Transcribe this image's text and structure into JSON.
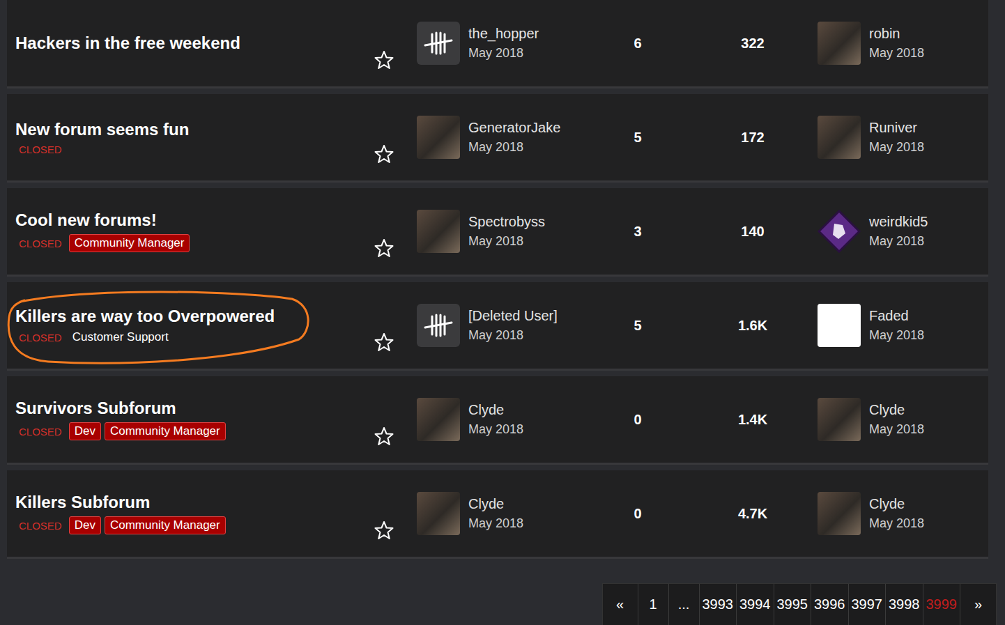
{
  "topics": [
    {
      "title": "Hackers in the free weekend",
      "tags": [],
      "starred": false,
      "annotated": false,
      "author": {
        "name": "the_hopper",
        "date": "May 2018",
        "avatar": "logo"
      },
      "comments": "6",
      "views": "322",
      "last": {
        "name": "robin",
        "date": "May 2018",
        "avatar": "photo"
      }
    },
    {
      "title": "New forum seems fun",
      "tags": [
        {
          "label": "CLOSED",
          "kind": "status"
        }
      ],
      "starred": false,
      "annotated": false,
      "author": {
        "name": "GeneratorJake",
        "date": "May 2018",
        "avatar": "photo"
      },
      "comments": "5",
      "views": "172",
      "last": {
        "name": "Runiver",
        "date": "May 2018",
        "avatar": "photo"
      }
    },
    {
      "title": "Cool new forums!",
      "tags": [
        {
          "label": "CLOSED",
          "kind": "status"
        },
        {
          "label": "Community Manager",
          "kind": "badge"
        }
      ],
      "starred": false,
      "annotated": false,
      "author": {
        "name": "Spectrobyss",
        "date": "May 2018",
        "avatar": "photo"
      },
      "comments": "3",
      "views": "140",
      "last": {
        "name": "weirdkid5",
        "date": "May 2018",
        "avatar": "perk"
      }
    },
    {
      "title": "Killers are way too Overpowered",
      "tags": [
        {
          "label": "CLOSED",
          "kind": "status"
        },
        {
          "label": "Customer Support",
          "kind": "plain"
        }
      ],
      "starred": false,
      "annotated": true,
      "author": {
        "name": "[Deleted User]",
        "date": "May 2018",
        "avatar": "logo"
      },
      "comments": "5",
      "views": "1.6K",
      "last": {
        "name": "Faded",
        "date": "May 2018",
        "avatar": "brand"
      }
    },
    {
      "title": "Survivors Subforum",
      "tags": [
        {
          "label": "CLOSED",
          "kind": "status"
        },
        {
          "label": "Dev",
          "kind": "badge"
        },
        {
          "label": "Community Manager",
          "kind": "badge"
        }
      ],
      "starred": false,
      "annotated": false,
      "author": {
        "name": "Clyde",
        "date": "May 2018",
        "avatar": "photo"
      },
      "comments": "0",
      "views": "1.4K",
      "last": {
        "name": "Clyde",
        "date": "May 2018",
        "avatar": "photo"
      }
    },
    {
      "title": "Killers Subforum",
      "tags": [
        {
          "label": "CLOSED",
          "kind": "status"
        },
        {
          "label": "Dev",
          "kind": "badge"
        },
        {
          "label": "Community Manager",
          "kind": "badge"
        }
      ],
      "starred": false,
      "annotated": false,
      "author": {
        "name": "Clyde",
        "date": "May 2018",
        "avatar": "photo"
      },
      "comments": "0",
      "views": "4.7K",
      "last": {
        "name": "Clyde",
        "date": "May 2018",
        "avatar": "photo"
      }
    }
  ],
  "pagination": {
    "prev": "«",
    "next": "»",
    "items": [
      {
        "label": "1",
        "selected": false
      },
      {
        "label": "...",
        "selected": false
      },
      {
        "label": "3993",
        "selected": false
      },
      {
        "label": "3994",
        "selected": false
      },
      {
        "label": "3995",
        "selected": false
      },
      {
        "label": "3996",
        "selected": false
      },
      {
        "label": "3997",
        "selected": false
      },
      {
        "label": "3998",
        "selected": false
      },
      {
        "label": "3999",
        "selected": true
      }
    ]
  }
}
